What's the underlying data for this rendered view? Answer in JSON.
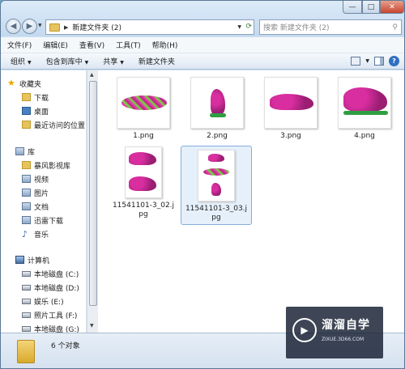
{
  "window": {
    "address": "新建文件夹 (2)",
    "search_placeholder": "搜索 新建文件夹 (2)"
  },
  "menu": [
    "文件(F)",
    "编辑(E)",
    "查看(V)",
    "工具(T)",
    "帮助(H)"
  ],
  "toolbar": [
    "组织",
    "包含到库中",
    "共享",
    "新建文件夹"
  ],
  "sidebar": {
    "favorites_label": "收藏夹",
    "favorites": [
      "下载",
      "桌面",
      "最近访问的位置"
    ],
    "libraries_label": "库",
    "libraries": [
      "暴风影视库",
      "视频",
      "图片",
      "文档",
      "迅雷下载",
      "音乐"
    ],
    "computer_label": "计算机",
    "drives": [
      "本地磁盘 (C:)",
      "本地磁盘 (D:)",
      "娱乐 (E:)",
      "照片工具 (F:)",
      "本地磁盘 (G:)"
    ]
  },
  "files": [
    {
      "name": "1.png"
    },
    {
      "name": "2.png"
    },
    {
      "name": "3.png"
    },
    {
      "name": "4.png"
    },
    {
      "name": "11541101-3_02.jpg",
      "line1": "11541101-3_02.j",
      "line2": "pg"
    },
    {
      "name": "11541101-3_03.jpg",
      "line1": "11541101-3_03.j",
      "line2": "pg",
      "selected": true
    }
  ],
  "status": {
    "count_text": "6 个对象"
  },
  "watermark": {
    "title": "溜溜自学",
    "subtitle": "ZIXUE.3D66.COM"
  }
}
